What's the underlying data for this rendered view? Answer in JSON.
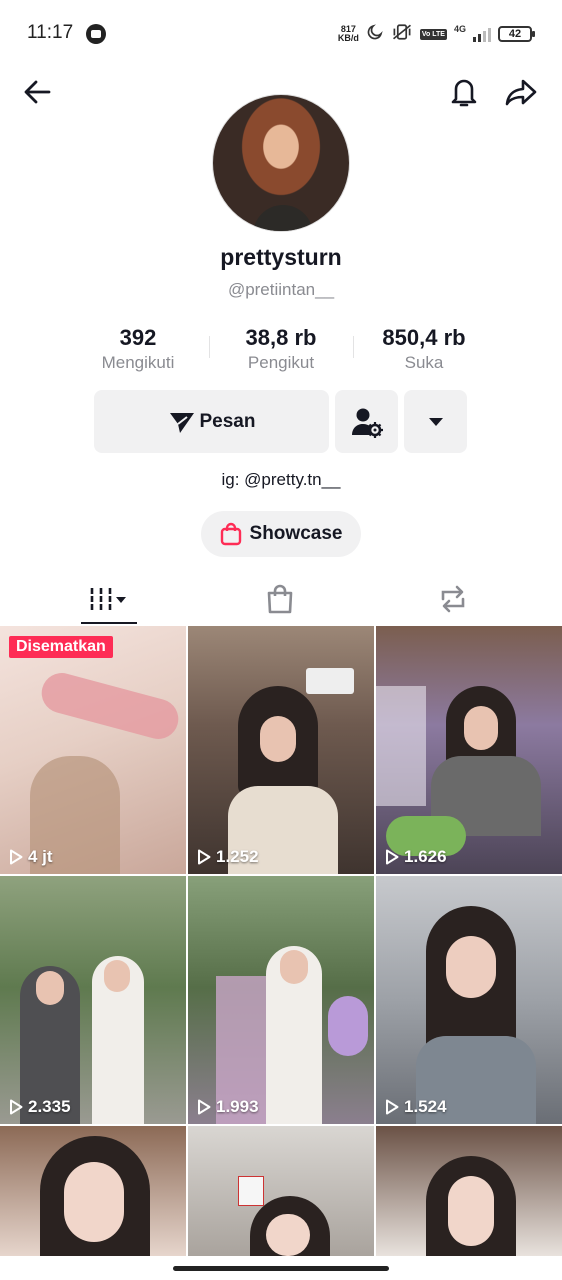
{
  "status_bar": {
    "time": "11:17",
    "net_speed_value": "817",
    "net_speed_unit": "KB/d",
    "network": "4G",
    "volte": "Vo LTE",
    "battery": "42"
  },
  "profile": {
    "display_name": "prettysturn",
    "username": "@pretiintan__",
    "bio": "ig: @pretty.tn__"
  },
  "stats": [
    {
      "value": "392",
      "label": "Mengikuti"
    },
    {
      "value": "38,8 rb",
      "label": "Pengikut"
    },
    {
      "value": "850,4 rb",
      "label": "Suka"
    }
  ],
  "actions": {
    "message_label": "Pesan",
    "showcase_label": "Showcase"
  },
  "videos": [
    {
      "views": "4 jt",
      "pinned_label": "Disematkan"
    },
    {
      "views": "1.252"
    },
    {
      "views": "1.626"
    },
    {
      "views": "2.335"
    },
    {
      "views": "1.993"
    },
    {
      "views": "1.524"
    },
    {
      "views": ""
    },
    {
      "views": ""
    },
    {
      "views": ""
    }
  ],
  "colors": {
    "accent": "#fe2c55",
    "text": "#161823",
    "secondary_text": "#8a8b91",
    "button_bg": "#f1f1f2"
  },
  "icons": [
    "back-arrow-icon",
    "bell-icon",
    "share-icon",
    "send-icon",
    "add-friend-settings-icon",
    "dropdown-icon",
    "shopping-bag-icon",
    "grid-icon",
    "shop-icon",
    "repost-icon",
    "play-icon"
  ]
}
